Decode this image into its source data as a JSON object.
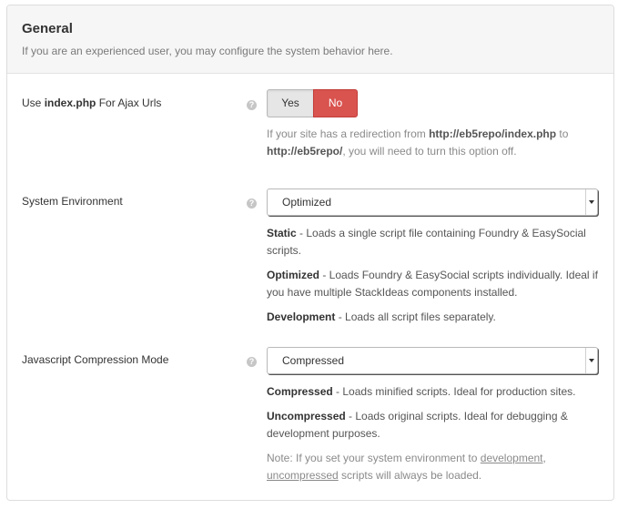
{
  "panel": {
    "title": "General",
    "description": "If you are an experienced user, you may configure the system behavior here."
  },
  "settings": {
    "ajax": {
      "label_prefix": "Use ",
      "label_bold": "index.php",
      "label_suffix": " For Ajax Urls",
      "help_icon": "question-icon",
      "yes_label": "Yes",
      "no_label": "No",
      "selected": "No",
      "note_1": "If your site has a redirection from ",
      "note_url_1": "http://eb5repo/index.php",
      "note_2": " to",
      "note_url_2": "http://eb5repo/",
      "note_3": ", you will need to turn this option off."
    },
    "environment": {
      "label": "System Environment",
      "help_icon": "question-icon",
      "selected": "Optimized",
      "options": [
        {
          "name": "Static",
          "text": " - Loads a single script file containing Foundry & EasySocial scripts."
        },
        {
          "name": "Optimized",
          "text": " - Loads Foundry & EasySocial scripts individually. Ideal if you have multiple StackIdeas components installed."
        },
        {
          "name": "Development",
          "text": " - Loads all script files separately."
        }
      ]
    },
    "compression": {
      "label": "Javascript Compression Mode",
      "help_icon": "question-icon",
      "selected": "Compressed",
      "options": [
        {
          "name": "Compressed",
          "text": " - Loads minified scripts. Ideal for production sites."
        },
        {
          "name": "Uncompressed",
          "text": " - Loads original scripts. Ideal for debugging & development purposes."
        }
      ],
      "note_1": "Note: If you set your system environment to ",
      "note_link_1": "development",
      "note_2": ",",
      "note_link_2": "uncompressed",
      "note_3": " scripts will always be loaded."
    }
  },
  "colors": {
    "danger": "#d9534f",
    "header_bg": "#f6f6f6"
  }
}
